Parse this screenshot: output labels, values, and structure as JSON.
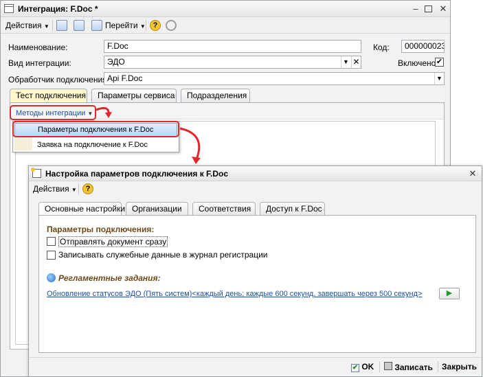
{
  "main": {
    "title": "Интеграция: F.Doc *",
    "toolbar": {
      "actions": "Действия",
      "goto": "Перейти",
      "help": "?"
    },
    "fields": {
      "name_label": "Наименование:",
      "name_value": "F.Doc",
      "code_label": "Код:",
      "code_value": "000000023",
      "type_label": "Вид интеграции:",
      "type_value": "ЭДО",
      "enabled_label": "Включено",
      "handler_label": "Обработчик подключения:",
      "handler_value": "Api F.Doc"
    },
    "tabs": [
      "Тест подключения",
      "Параметры сервиса",
      "Подразделения"
    ],
    "methods_button": "Методы интеграции",
    "menu": [
      "Параметры подключения к F.Doc",
      "Заявка на подключение к F.Doc"
    ]
  },
  "dialog": {
    "title": "Настройка параметров подключения к F.Doc",
    "toolbar": {
      "actions": "Действия",
      "help": "?"
    },
    "tabs": [
      "Основные настройки",
      "Организации",
      "Соответствия",
      "Доступ к F.Doc"
    ],
    "section1": "Параметры подключения:",
    "check1": "Отправлять документ сразу",
    "check2": "Записывать служебные данные в журнал регистрации",
    "section2": "Регламентные задания:",
    "task_link": "Обновление статусов ЭДО (Пять систем)<каждый день; каждые 600 секунд, завершать через 500 секунд>",
    "buttons": {
      "ok": "OK",
      "save": "Записать",
      "close": "Закрыть"
    }
  },
  "colors": {
    "highlight": "#e3262b",
    "section": "#6b4a17",
    "link": "#1c4fa5"
  }
}
